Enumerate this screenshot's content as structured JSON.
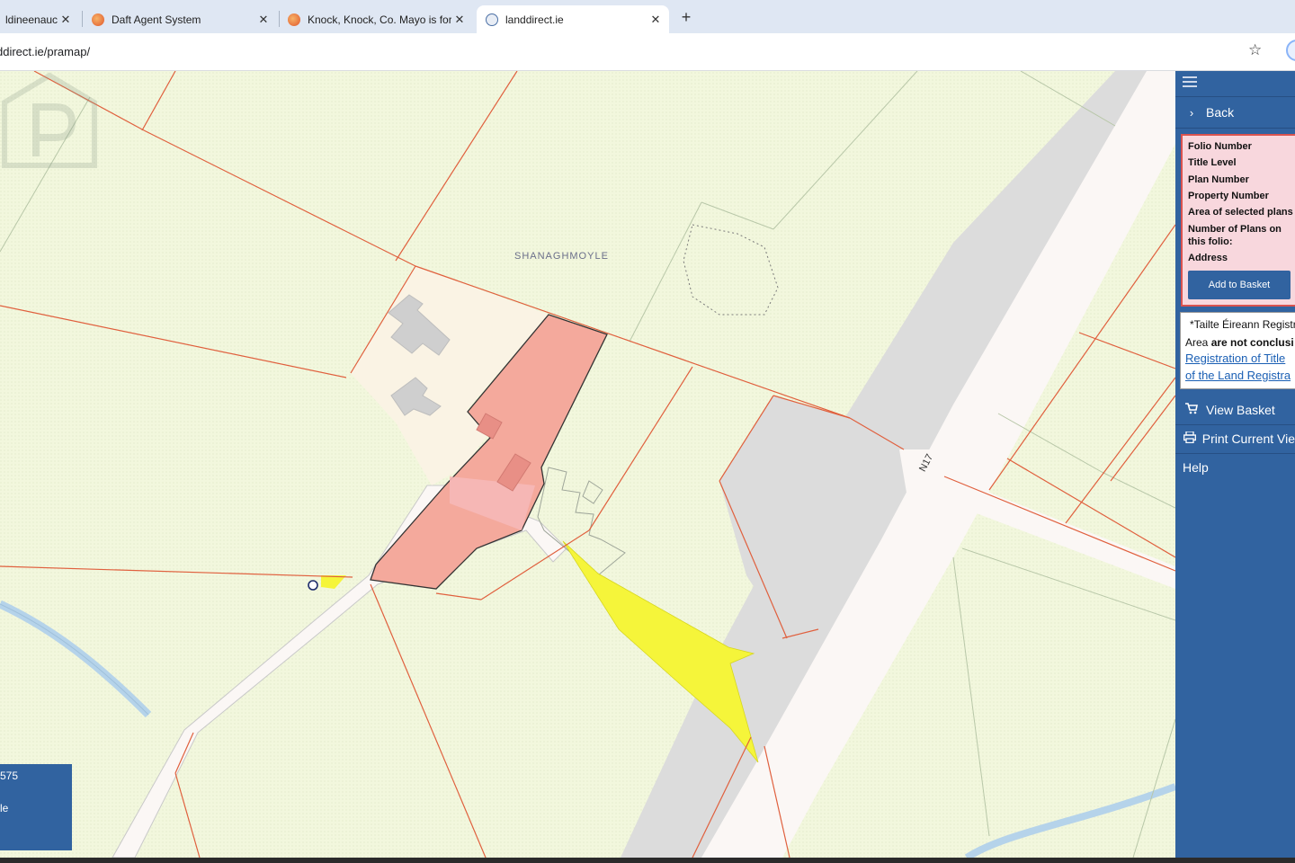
{
  "browser": {
    "tabs": [
      {
        "title": "ldineenauct",
        "favicon": "circle-icon",
        "active": false
      },
      {
        "title": "Daft Agent System",
        "favicon": "orange-logo-icon",
        "active": false
      },
      {
        "title": "Knock, Knock, Co. Mayo is for s",
        "favicon": "orange-logo-icon",
        "active": false
      },
      {
        "title": "landdirect.ie",
        "favicon": "globe-icon",
        "active": true
      }
    ],
    "close_glyph": "✕",
    "new_tab_glyph": "+",
    "url": "ddirect.ie/pramap/",
    "bookmark_glyph": "☆"
  },
  "map": {
    "townland_label": "SHANAGHMOYLE",
    "road_label": "N17",
    "infobox": {
      "line1": "575",
      "line2": "le"
    }
  },
  "sidebar": {
    "back_label": "Back",
    "folio_fields": [
      "Folio Number",
      "Title Level",
      "Plan Number",
      "Property Number",
      "Area of selected plans",
      "Number of Plans on",
      "this folio:",
      "Address"
    ],
    "add_to_basket": "Add to Basket",
    "disclaimer": {
      "line1": "*Tailte Éireann Registr",
      "line2_pre": "Area ",
      "line2_bold": "are not conclusi",
      "link1": "Registration of Title",
      "link2": "of the Land Registra"
    },
    "view_basket": "View Basket",
    "print_view": "Print Current Vie",
    "help": "Help"
  },
  "colors": {
    "sidebar_bg": "#3163a0",
    "map_bg": "#f2f7dd",
    "boundary_line": "#e0603e",
    "selected_parcel": "#f4a99c",
    "highlight_yellow": "#f5f53a",
    "road_fill": "#fbf7f5",
    "verge_grey": "#dcdcdc"
  }
}
